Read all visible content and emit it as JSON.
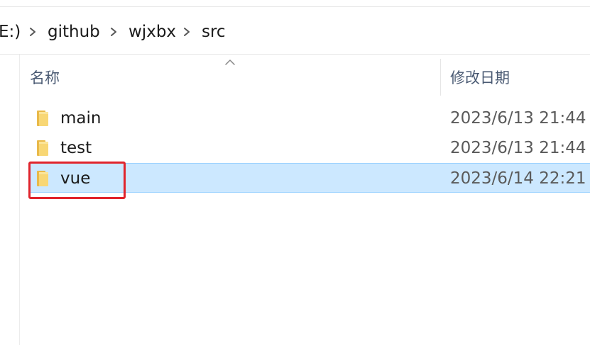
{
  "breadcrumb": {
    "items": [
      {
        "label": "E:)"
      },
      {
        "label": "github"
      },
      {
        "label": "wjxbx"
      },
      {
        "label": "src"
      }
    ]
  },
  "columns": {
    "name": "名称",
    "modified": "修改日期"
  },
  "files": [
    {
      "name": "main",
      "modified": "2023/6/13 21:44",
      "type": "folder",
      "selected": false
    },
    {
      "name": "test",
      "modified": "2023/6/13 21:44",
      "type": "folder",
      "selected": false
    },
    {
      "name": "vue",
      "modified": "2023/6/14 22:21",
      "type": "folder",
      "selected": true
    }
  ],
  "colors": {
    "selection_bg": "#cce8ff",
    "selection_border": "#99d1ff",
    "highlight_box": "#e0242c",
    "folder_yellow": "#f8d775"
  },
  "annotation": {
    "highlighted_item": "vue"
  }
}
